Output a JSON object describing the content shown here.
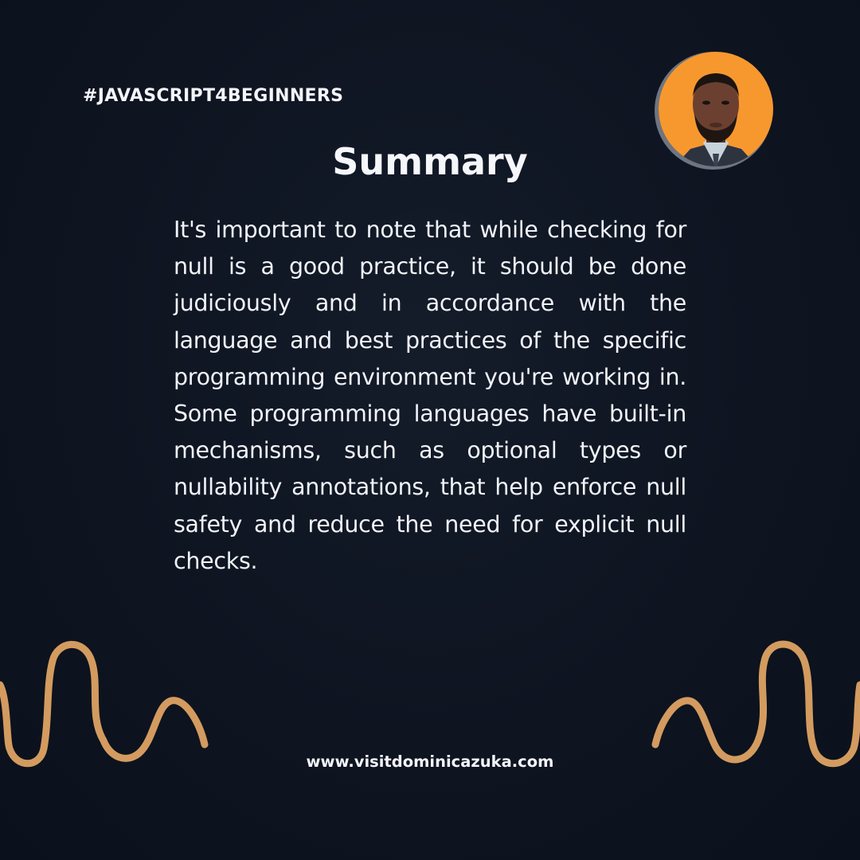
{
  "header": {
    "hashtag": "#JAVASCRIPT4BEGINNERS"
  },
  "avatar": {
    "description": "profile photo of author on orange background",
    "background_color": "#f7982f"
  },
  "title": "Summary",
  "body": "It's important to note that while checking for null is a good practice, it should be done judiciously and in accordance with the language and best practices of the specific programming environment you're working in. Some programming languages have built-in mechanisms, such as optional types or nullability annotations, that help enforce null safety and reduce the need for explicit null checks.",
  "footer": {
    "website": "www.visitdominicazuka.com"
  },
  "colors": {
    "background": "#0d131e",
    "text": "#f3f5fa",
    "accent_squiggle": "#d39b5f"
  }
}
